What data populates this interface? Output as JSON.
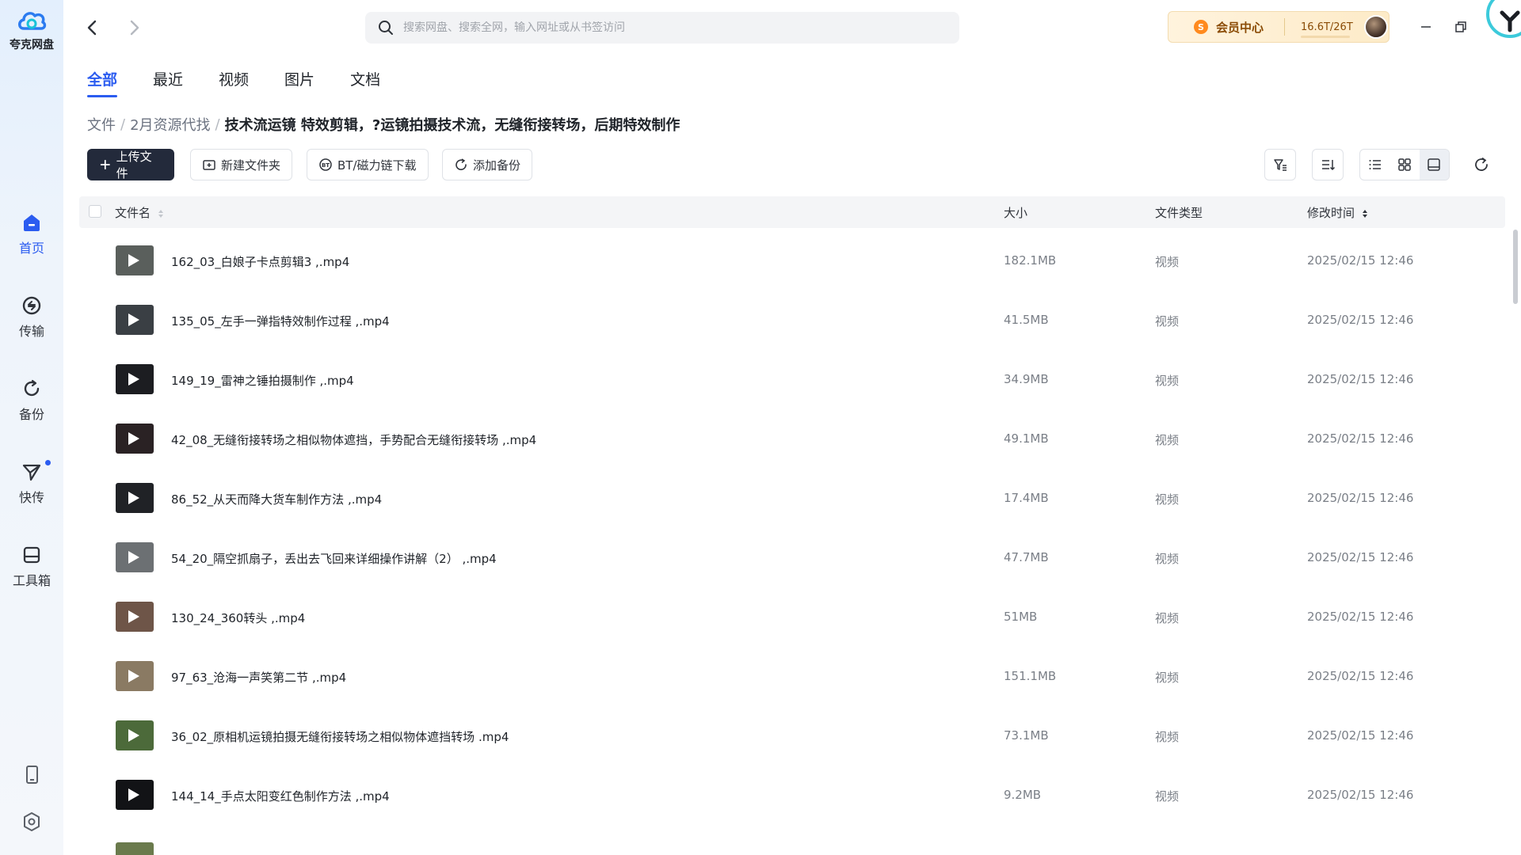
{
  "app": {
    "name": "夸克网盘"
  },
  "sidebar": {
    "items": [
      {
        "label": "首页",
        "icon": "home-icon",
        "active": true
      },
      {
        "label": "传输",
        "icon": "transfer-icon",
        "active": false
      },
      {
        "label": "备份",
        "icon": "backup-icon",
        "active": false
      },
      {
        "label": "快传",
        "icon": "quick-send-icon",
        "active": false,
        "badge": true
      },
      {
        "label": "工具箱",
        "icon": "toolbox-icon",
        "active": false
      }
    ],
    "bottom_icons": [
      "phone-icon",
      "settings-icon"
    ]
  },
  "search": {
    "placeholder": "搜索网盘、搜索全网，输入网址或从书签访问",
    "value": ""
  },
  "vip": {
    "label": "会员中心",
    "storage": "16.6T/26T",
    "storage_used_fraction": 0.64
  },
  "tabs": [
    {
      "label": "全部",
      "active": true
    },
    {
      "label": "最近",
      "active": false
    },
    {
      "label": "视频",
      "active": false
    },
    {
      "label": "图片",
      "active": false
    },
    {
      "label": "文档",
      "active": false
    }
  ],
  "breadcrumb": {
    "items": [
      "文件",
      "2月资源代找"
    ],
    "current": "技术流运镜 特效剪辑，?运镜拍摄技术流，无缝衔接转场，后期特效制作"
  },
  "toolbar": {
    "upload": "上传文件",
    "new_folder": "新建文件夹",
    "bt_download": "BT/磁力链下载",
    "add_backup": "添加备份"
  },
  "table": {
    "headers": {
      "name": "文件名",
      "size": "大小",
      "type": "文件类型",
      "modified": "修改时间"
    },
    "rows": [
      {
        "name": "162_03_白娘子卡点剪辑3  ,.mp4",
        "size": "182.1MB",
        "type": "视频",
        "modified": "2025/02/15 12:46",
        "thumb": "#5a5f5c"
      },
      {
        "name": "135_05_左手一弹指特效制作过程  ,.mp4",
        "size": "41.5MB",
        "type": "视频",
        "modified": "2025/02/15 12:46",
        "thumb": "#3a3f44"
      },
      {
        "name": "149_19_雷神之锤拍摄制作  ,.mp4",
        "size": "34.9MB",
        "type": "视频",
        "modified": "2025/02/15 12:46",
        "thumb": "#1c1d21"
      },
      {
        "name": "42_08_无缝衔接转场之相似物体遮挡，手势配合无缝衔接转场  ,.mp4",
        "size": "49.1MB",
        "type": "视频",
        "modified": "2025/02/15 12:46",
        "thumb": "#2a2224"
      },
      {
        "name": "86_52_从天而降大货车制作方法  ,.mp4",
        "size": "17.4MB",
        "type": "视频",
        "modified": "2025/02/15 12:46",
        "thumb": "#202226"
      },
      {
        "name": "54_20_隔空抓扇子，丢出去飞回来详细操作讲解（2）  ,.mp4",
        "size": "47.7MB",
        "type": "视频",
        "modified": "2025/02/15 12:46",
        "thumb": "#6c7073"
      },
      {
        "name": "130_24_360转头  ,.mp4",
        "size": "51MB",
        "type": "视频",
        "modified": "2025/02/15 12:46",
        "thumb": "#6e5548"
      },
      {
        "name": "97_63_沧海一声笑第二节  ,.mp4",
        "size": "151.1MB",
        "type": "视频",
        "modified": "2025/02/15 12:46",
        "thumb": "#8a7a63"
      },
      {
        "name": "36_02_原相机运镜拍摄无缝衔接转场之相似物体遮挡转场 .mp4",
        "size": "73.1MB",
        "type": "视频",
        "modified": "2025/02/15 12:46",
        "thumb": "#4c6a3a"
      },
      {
        "name": "144_14_手点太阳变红色制作方法  ,.mp4",
        "size": "9.2MB",
        "type": "视频",
        "modified": "2025/02/15 12:46",
        "thumb": "#121316"
      },
      {
        "name": "",
        "size": "",
        "type": "",
        "modified": "",
        "thumb": "#6a7a4c"
      }
    ]
  },
  "colors": {
    "accent": "#2b5cf0",
    "primary_button": "#232a3b",
    "vip_text": "#8a4b05"
  }
}
